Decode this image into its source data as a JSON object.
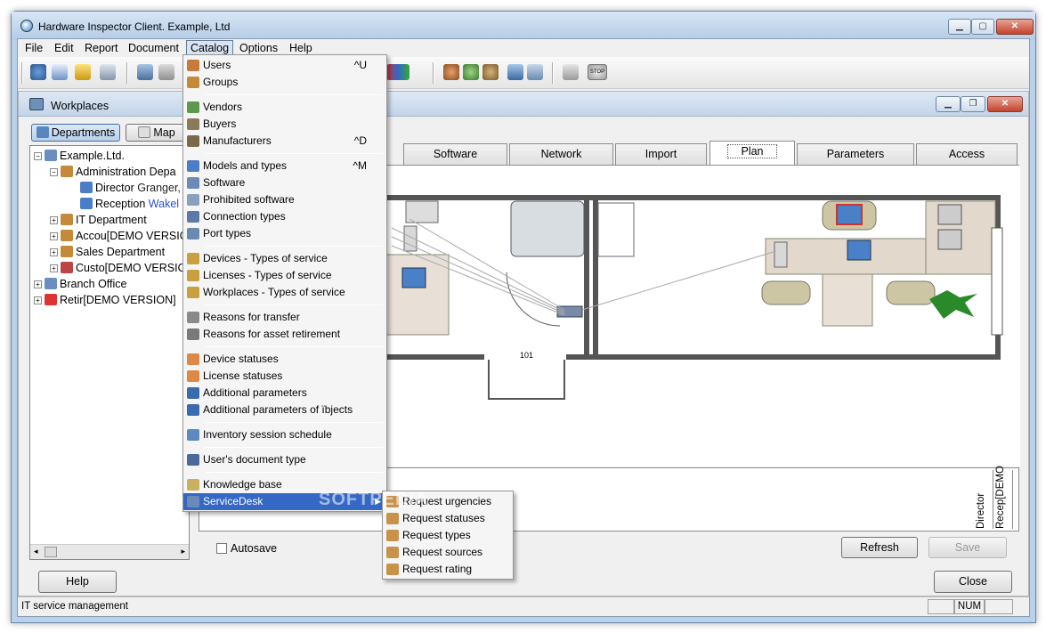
{
  "window": {
    "title": "Hardware Inspector Client. Example, Ltd"
  },
  "menubar": {
    "items": [
      "File",
      "Edit",
      "Report",
      "Document",
      "Catalog",
      "Options",
      "Help"
    ]
  },
  "child": {
    "title": "Workplaces"
  },
  "left_tabs": {
    "departments": "Departments",
    "map": "Map"
  },
  "tree": [
    {
      "label": "Example.Ltd.",
      "level": 0
    },
    {
      "label": "Administration Depa",
      "level": 1
    },
    {
      "label": "Director",
      "extra": "Granger,",
      "level": 2
    },
    {
      "label": "Reception",
      "extra": "Wakel",
      "level": 2
    },
    {
      "label": "IT Department",
      "level": 1
    },
    {
      "label": "Accou[DEMO VERSIO",
      "level": 1
    },
    {
      "label": "Sales Department",
      "level": 1
    },
    {
      "label": "Custo[DEMO VERSIO",
      "level": 1
    },
    {
      "label": "Branch Office",
      "level": 0
    },
    {
      "label": "Retir[DEMO VERSION]",
      "level": 0
    }
  ],
  "tabs": [
    "Software",
    "Network",
    "Import",
    "Plan",
    "Parameters",
    "Access"
  ],
  "plan": {
    "door_label": "101"
  },
  "lowpanel": {
    "vertical_labels": [
      "Director",
      "Recep[DEMO"
    ]
  },
  "autosave_label": "Autosave",
  "buttons": {
    "refresh": "Refresh",
    "save": "Save",
    "help": "Help",
    "close": "Close"
  },
  "catalog_menu": [
    {
      "label": "Users",
      "shortcut": "^U",
      "icon": "user-icon"
    },
    {
      "label": "Groups",
      "shortcut": "",
      "icon": "group-icon"
    },
    {
      "sep": true
    },
    {
      "label": "Vendors",
      "shortcut": "",
      "icon": "vendor-icon"
    },
    {
      "label": "Buyers",
      "shortcut": "",
      "icon": "buyer-icon"
    },
    {
      "label": "Manufacturers",
      "shortcut": "^D",
      "icon": "manufacturer-icon"
    },
    {
      "sep": true
    },
    {
      "label": "Models and types",
      "shortcut": "^M",
      "icon": "models-icon"
    },
    {
      "label": "Software",
      "shortcut": "",
      "icon": "software-icon"
    },
    {
      "label": "Prohibited software",
      "shortcut": "",
      "icon": "prohibited-icon"
    },
    {
      "label": "Connection types",
      "shortcut": "",
      "icon": "connection-icon"
    },
    {
      "label": "Port types",
      "shortcut": "",
      "icon": "port-icon"
    },
    {
      "sep": true
    },
    {
      "label": "Devices - Types of service",
      "shortcut": "",
      "icon": "service-icon"
    },
    {
      "label": "Licenses - Types of service",
      "shortcut": "",
      "icon": "service-icon"
    },
    {
      "label": "Workplaces - Types of service",
      "shortcut": "",
      "icon": "service-icon"
    },
    {
      "sep": true
    },
    {
      "label": "Reasons for transfer",
      "shortcut": "",
      "icon": "transfer-icon"
    },
    {
      "label": "Reasons for asset retirement",
      "shortcut": "",
      "icon": "retirement-icon"
    },
    {
      "sep": true
    },
    {
      "label": "Device statuses",
      "shortcut": "",
      "icon": "status-icon"
    },
    {
      "label": "License statuses",
      "shortcut": "",
      "icon": "status-icon"
    },
    {
      "label": "Additional parameters",
      "shortcut": "",
      "icon": "params-icon"
    },
    {
      "label": "Additional parameters of ïbjects",
      "shortcut": "",
      "icon": "params-icon"
    },
    {
      "sep": true
    },
    {
      "label": "Inventory session schedule",
      "shortcut": "",
      "icon": "schedule-icon"
    },
    {
      "sep": true
    },
    {
      "label": "User's document type",
      "shortcut": "",
      "icon": "document-icon"
    },
    {
      "sep": true
    },
    {
      "label": "Knowledge base",
      "shortcut": "",
      "icon": "book-icon"
    },
    {
      "label": "ServiceDesk",
      "shortcut": "",
      "icon": "servicedesk-icon",
      "submenu": true,
      "highlighted": true
    }
  ],
  "servicedesk_submenu": [
    "Request urgencies",
    "Request statuses",
    "Request types",
    "Request sources",
    "Request rating"
  ],
  "statusbar": {
    "text": "IT service management",
    "num": "NUM"
  },
  "watermark": "SOFTPEDIA"
}
